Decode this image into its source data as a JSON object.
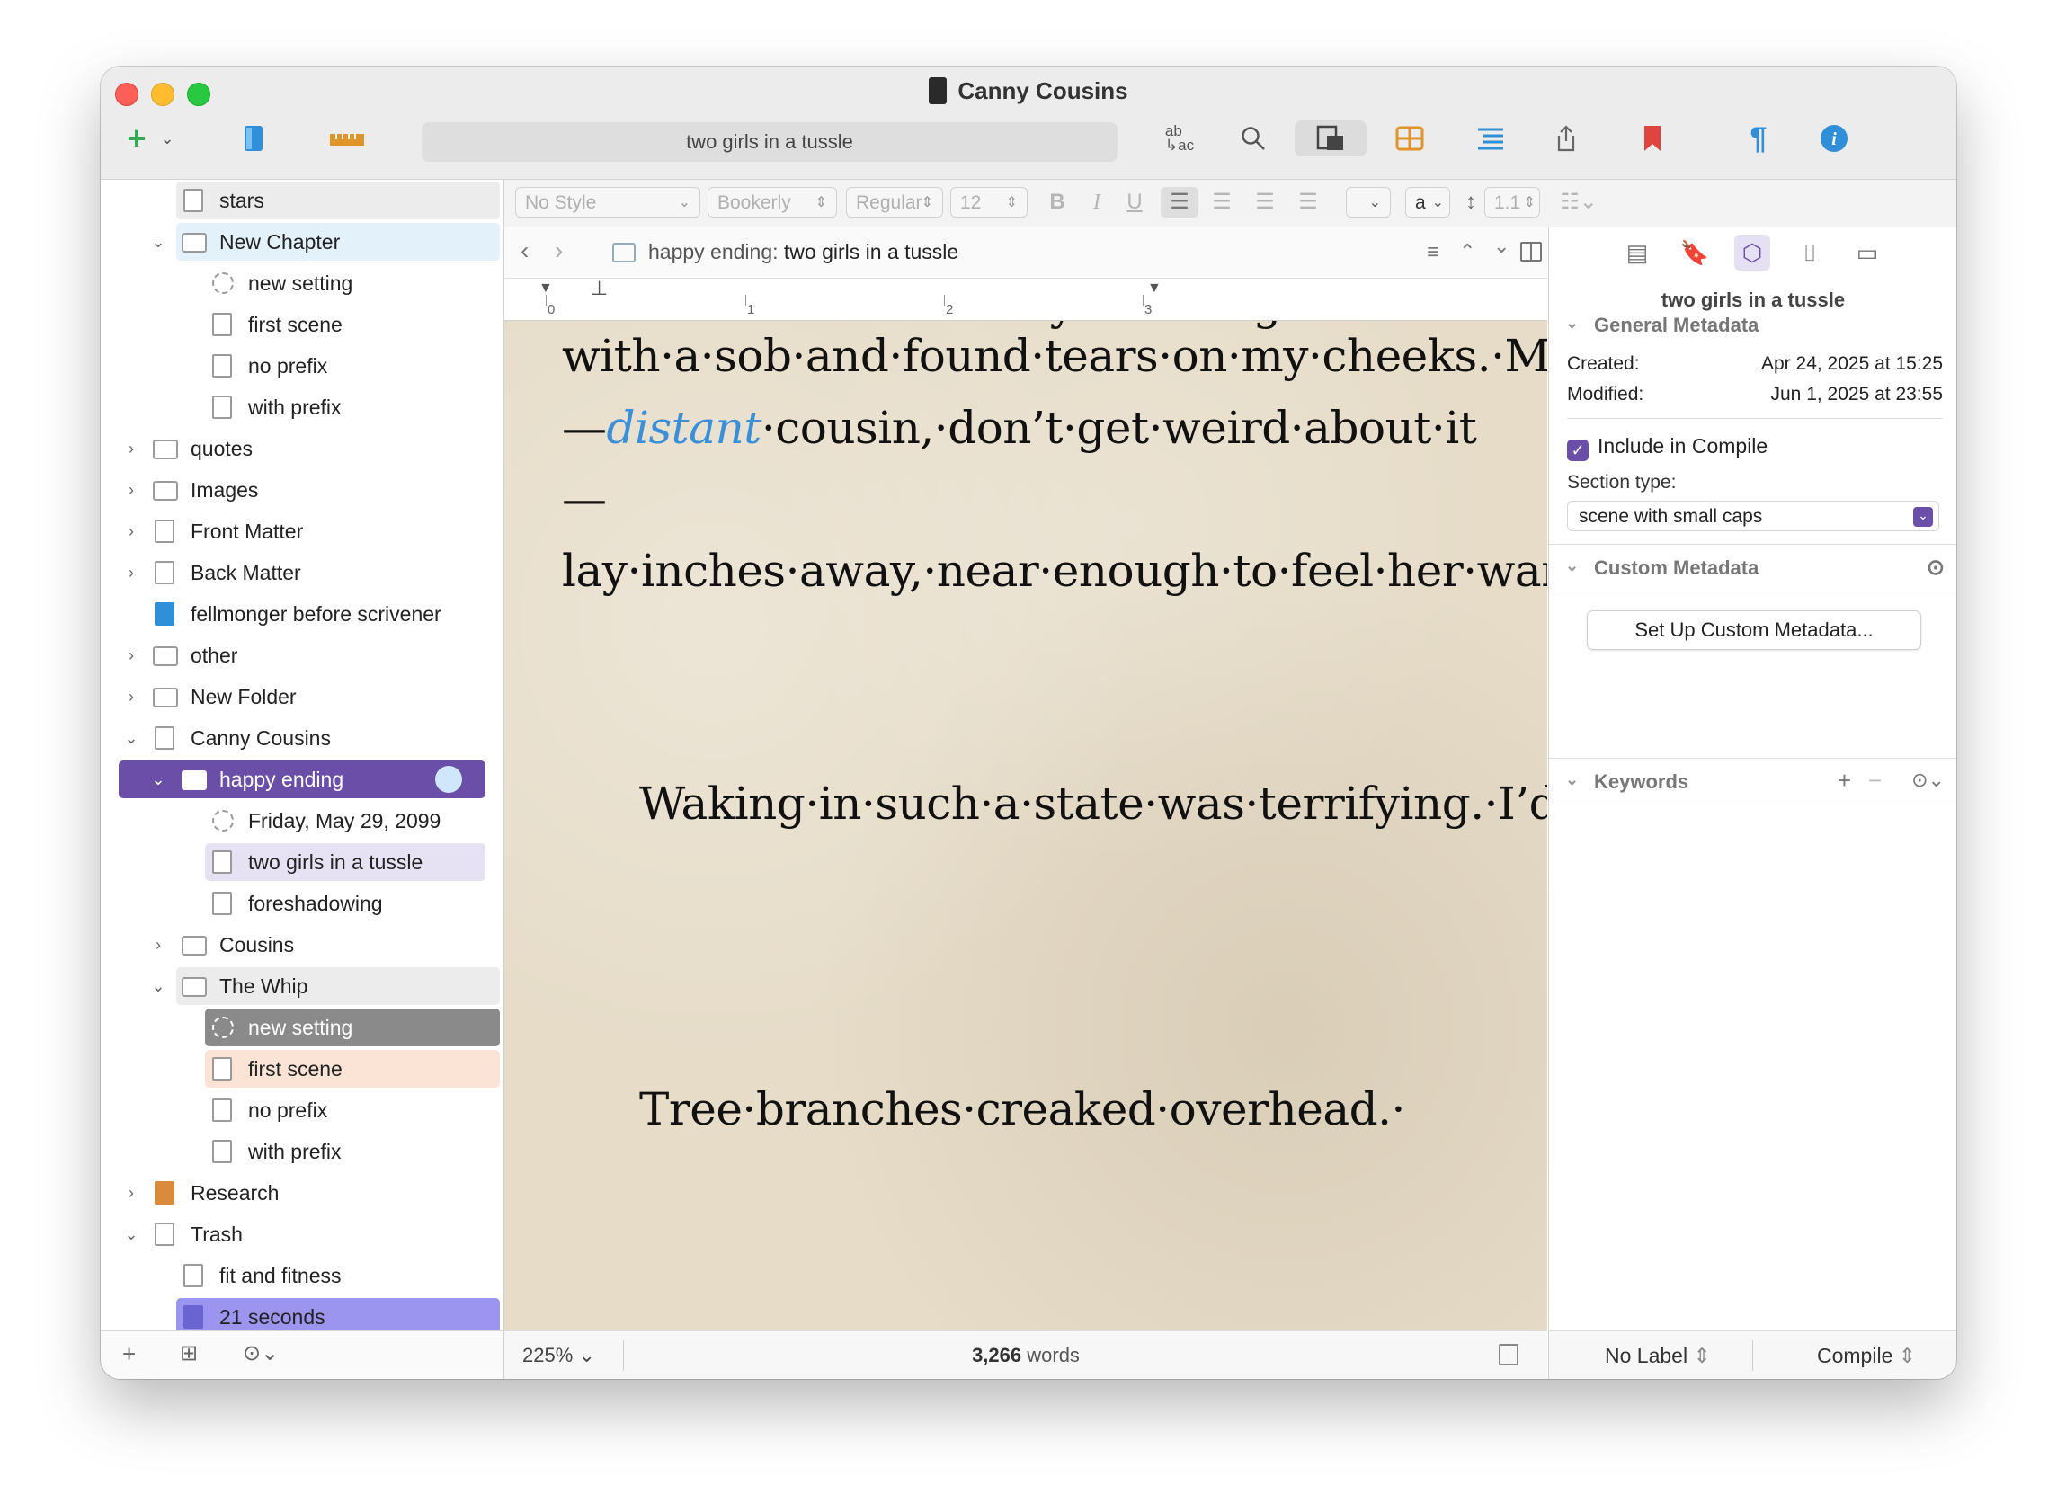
{
  "window": {
    "title": "Canny Cousins"
  },
  "toolbar": {
    "search_text": "two girls in a tussle",
    "add_icon": "plus-icon",
    "colors": {
      "add": "#34a853",
      "binder": "#2f8fd8",
      "ruler": "#e0952b",
      "bookmark": "#e0443e",
      "info": "#2f8fd8",
      "grid": "#e0952b",
      "pilcrow": "#2f8fd8"
    }
  },
  "binder": {
    "items": [
      {
        "label": "stars"
      },
      {
        "label": "New Chapter"
      },
      {
        "label": "new setting"
      },
      {
        "label": "first scene"
      },
      {
        "label": "no prefix"
      },
      {
        "label": "with prefix"
      },
      {
        "label": "quotes"
      },
      {
        "label": "Images"
      },
      {
        "label": "Front Matter"
      },
      {
        "label": "Back Matter"
      },
      {
        "label": "fellmonger before scrivener"
      },
      {
        "label": "other"
      },
      {
        "label": "New Folder"
      },
      {
        "label": "Canny Cousins"
      },
      {
        "label": "happy ending"
      },
      {
        "label": "Friday, May 29, 2099"
      },
      {
        "label": "two girls in a tussle"
      },
      {
        "label": "foreshadowing"
      },
      {
        "label": "Cousins"
      },
      {
        "label": "The Whip"
      },
      {
        "label": "new setting"
      },
      {
        "label": "first scene"
      },
      {
        "label": "no prefix"
      },
      {
        "label": "with prefix"
      },
      {
        "label": "Research"
      },
      {
        "label": "Trash"
      },
      {
        "label": "fit and fitness"
      },
      {
        "label": "21 seconds"
      }
    ],
    "selected_color": "#6a4ea8"
  },
  "formatbar": {
    "style": "No Style",
    "font": "Bookerly",
    "weight": "Regular",
    "size": "12",
    "bold": "B",
    "italic": "I",
    "underline": "U",
    "color_letter": "a",
    "line_spacing": "1.1"
  },
  "editor_header": {
    "path_prefix": "happy ending:",
    "path_title": "two girls in a tussle"
  },
  "ruler": {
    "n0": "0",
    "n1": "1",
    "n2": "2",
    "n3": "3"
  },
  "editor": {
    "para1_a": "with·a·sob·and·found·tears·on·my·cheeks.·My·cousin·Ansel—",
    "para1_em": "distant",
    "para1_b": "·cousin,·don’t·get·weird·about·it—lay·inches·away,·near·enough·to·feel·her·warmth·but·painfully·far.·I·hated·the·space·between·us,·no·matter·how·slight.",
    "para2": "Waking·in·such·a·state·was·terrifying.·I’d·worked·hard·the·past·two·years·to·keep·my·emotions·in·check,·and·still·it·wasn’t·good·enough.·Going·back·to·sleep·would·be·safest,·but·that·wouldn’t·happen·now.",
    "para3": "Tree·branches·creaked·overhead.·",
    "cut_line": "I·woke·in·the·too-early·morning",
    "pilcrow": "¶"
  },
  "editor_footer": {
    "zoom": "225%",
    "word_count": "3,266",
    "words_label": "words"
  },
  "inspector": {
    "doc_title": "two girls in a tussle",
    "general_metadata": "General Metadata",
    "created_label": "Created:",
    "created_value": "Apr 24, 2025 at 15:25",
    "modified_label": "Modified:",
    "modified_value": "Jun 1, 2025 at 23:55",
    "include_compile": "Include in Compile",
    "section_type_label": "Section type:",
    "section_type_value": "scene with small caps",
    "custom_metadata": "Custom Metadata",
    "setup_button": "Set Up Custom Metadata...",
    "keywords": "Keywords",
    "label_value": "No Label",
    "compile": "Compile"
  }
}
